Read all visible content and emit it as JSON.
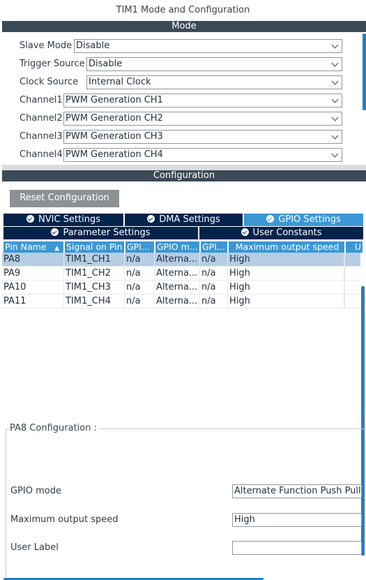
{
  "window": {
    "title": "TIM1 Mode and Configuration"
  },
  "mode": {
    "header": "Mode",
    "rows": [
      {
        "label": "Slave Mode",
        "value": "Disable"
      },
      {
        "label": "Trigger Source",
        "value": "Disable"
      },
      {
        "label": "Clock Source",
        "value": "Internal Clock"
      },
      {
        "label": "Channel1",
        "value": "PWM Generation CH1"
      },
      {
        "label": "Channel2",
        "value": "PWM Generation CH2"
      },
      {
        "label": "Channel3",
        "value": "PWM Generation CH3"
      },
      {
        "label": "Channel4",
        "value": "PWM Generation CH4"
      }
    ]
  },
  "configuration": {
    "header": "Configuration",
    "reset_button": "Reset Configuration",
    "tabs_row1": [
      "NVIC Settings",
      "DMA Settings",
      "GPIO Settings"
    ],
    "tabs_row2": [
      "Parameter Settings",
      "User Constants"
    ],
    "active_tab": "GPIO Settings"
  },
  "gpio_table": {
    "columns": [
      "Pin Name",
      "Signal on Pin",
      "GPI...",
      "GPIO m...",
      "GPI...",
      "Maximum output speed",
      "U"
    ],
    "rows": [
      [
        "PA8",
        "TIM1_CH1",
        "n/a",
        "Alterna...",
        "n/a",
        "High"
      ],
      [
        "PA9",
        "TIM1_CH2",
        "n/a",
        "Alterna...",
        "n/a",
        "High"
      ],
      [
        "PA10",
        "TIM1_CH3",
        "n/a",
        "Alterna...",
        "n/a",
        "High"
      ],
      [
        "PA11",
        "TIM1_CH4",
        "n/a",
        "Alterna...",
        "n/a",
        "High"
      ]
    ],
    "selected_row": 0
  },
  "pin_config": {
    "title": "PA8 Configuration :",
    "fields": [
      {
        "label": "GPIO mode",
        "value": "Alternate Function Push Pull"
      },
      {
        "label": "Maximum output speed",
        "value": "High"
      },
      {
        "label": "User Label",
        "value": ""
      }
    ]
  },
  "colors": {
    "header_bar": "#3c4a57",
    "tab_dark": "#03234b",
    "tab_active": "#3c97d3",
    "selected_row": "#b7cde3",
    "scrollbar": "#1f80c5",
    "button": "#8c9196"
  }
}
